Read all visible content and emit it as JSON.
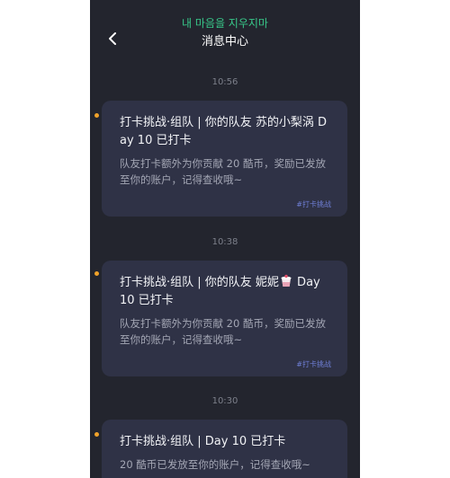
{
  "header": {
    "top_note": "내 마음을 지우지마",
    "title": "消息中心",
    "back_icon": "chevron-left-icon"
  },
  "messages": [
    {
      "time": "10:56",
      "title": "打卡挑战·组队 | 你的队友 苏的小梨涡 Day 10  已打卡",
      "body": "队友打卡额外为你贡献 20 酷币，奖励已发放至你的账户，记得查收哦~",
      "tag": "#打卡挑战"
    },
    {
      "time": "10:38",
      "title_prefix": "打卡挑战·组队 | 你的队友 妮妮",
      "title_icon": "yogurt-cup-icon",
      "title_suffix": " Day 10  已打卡",
      "body": "队友打卡额外为你贡献 20 酷币，奖励已发放至你的账户，记得查收哦~",
      "tag": "#打卡挑战"
    },
    {
      "time": "10:30",
      "title": "打卡挑战·组队 |  Day 10  已打卡",
      "body": "20 酷币已发放至你的账户，记得查收哦~"
    }
  ],
  "colors": {
    "background": "#23252e",
    "card": "#2f3246",
    "accent_green": "#38c98a",
    "unread_dot": "#f0a22a",
    "tag": "#6f7fd6"
  }
}
